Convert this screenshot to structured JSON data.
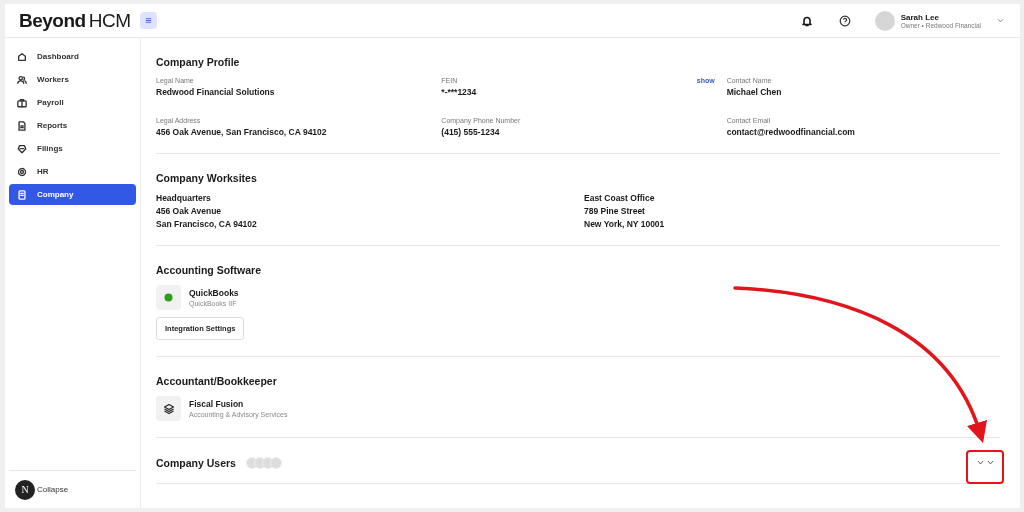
{
  "header": {
    "logo": {
      "brand": "Beyond",
      "suffix": "HCM"
    },
    "user": {
      "name": "Sarah Lee",
      "subtitle": "Owner • Redwood Financial"
    }
  },
  "sidebar": {
    "items": [
      {
        "label": "Dashboard",
        "selected": false
      },
      {
        "label": "Workers",
        "selected": false
      },
      {
        "label": "Payroll",
        "selected": false
      },
      {
        "label": "Reports",
        "selected": false
      },
      {
        "label": "Filings",
        "selected": false
      },
      {
        "label": "HR",
        "selected": false
      },
      {
        "label": "Company",
        "selected": true
      }
    ],
    "collapse": {
      "badge": "N",
      "label": "Collapse"
    }
  },
  "sections": [
    {
      "kind": "fields",
      "title": "Company Profile",
      "fields": [
        {
          "label": "Legal Name",
          "value": "Redwood Financial Solutions"
        },
        {
          "label": "FEIN",
          "value": "*-***1234",
          "action": "show"
        },
        {
          "label": "Contact Name",
          "value": "Michael Chen"
        },
        {
          "label": "Legal Address",
          "value": "456 Oak Avenue, San Francisco, CA 94102"
        },
        {
          "label": "Company Phone Number",
          "value": "(415) 555-1234"
        },
        {
          "label": "Contact Email",
          "value": "contact@redwoodfinancial.com"
        }
      ]
    },
    {
      "kind": "worksites",
      "title": "Company Worksites",
      "sites": [
        {
          "lines": [
            "Headquarters",
            "456 Oak Avenue",
            "San Francisco, CA 94102"
          ]
        },
        {
          "lines": [
            "East Coast Office",
            "789 Pine Street",
            "New York, NY 10001"
          ]
        }
      ]
    },
    {
      "kind": "software",
      "title": "Accounting Software",
      "name": "QuickBooks",
      "subtitle": "QuickBooks IIF",
      "button": "Integration Settings"
    },
    {
      "kind": "accountant",
      "title": "Accountant/Bookkeeper",
      "name": "Fiscal Fusion",
      "subtitle": "Accounting & Advisory Services"
    },
    {
      "kind": "users",
      "title": "Company Users",
      "expanded": false
    }
  ]
}
